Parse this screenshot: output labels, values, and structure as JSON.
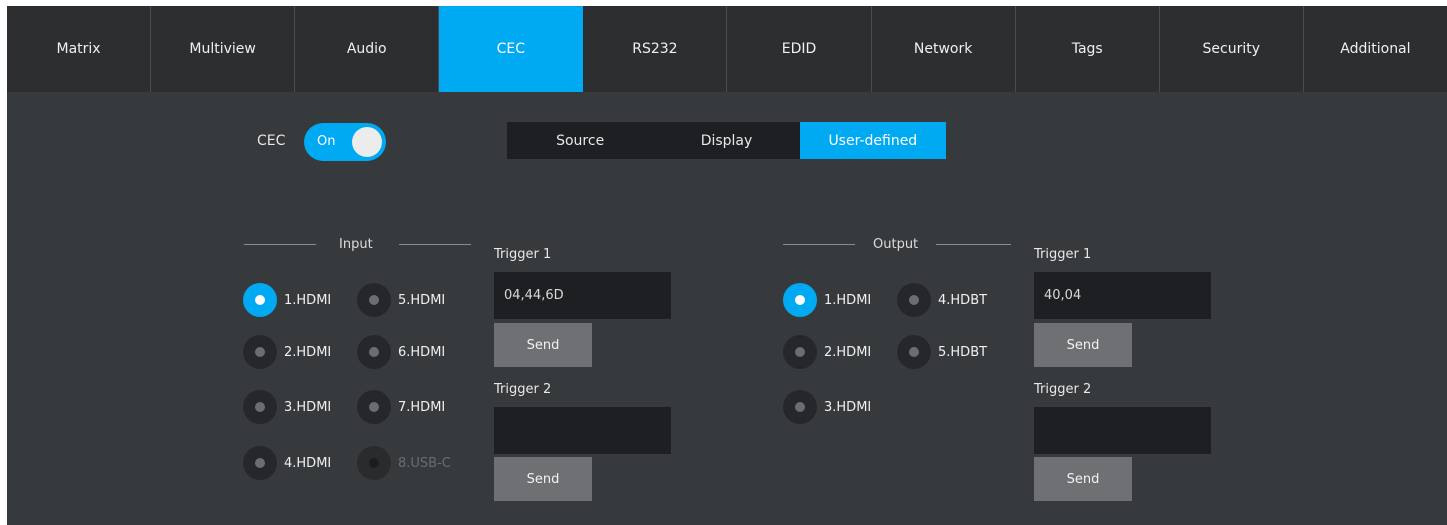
{
  "tabs": [
    {
      "label": "Matrix"
    },
    {
      "label": "Multiview"
    },
    {
      "label": "Audio"
    },
    {
      "label": "CEC"
    },
    {
      "label": "RS232"
    },
    {
      "label": "EDID"
    },
    {
      "label": "Network"
    },
    {
      "label": "Tags"
    },
    {
      "label": "Security"
    },
    {
      "label": "Additional"
    }
  ],
  "active_tab": "CEC",
  "cec": {
    "label": "CEC",
    "toggle_text": "On",
    "enabled": true
  },
  "mode_tabs": [
    {
      "label": "Source"
    },
    {
      "label": "Display"
    },
    {
      "label": "User-defined"
    }
  ],
  "active_mode": "User-defined",
  "input": {
    "title": "Input",
    "options": [
      {
        "label": "1.HDMI",
        "selected": true
      },
      {
        "label": "5.HDMI"
      },
      {
        "label": "2.HDMI"
      },
      {
        "label": "6.HDMI"
      },
      {
        "label": "3.HDMI"
      },
      {
        "label": "7.HDMI"
      },
      {
        "label": "4.HDMI"
      },
      {
        "label": "8.USB-C",
        "disabled": true
      }
    ],
    "trigger1": {
      "label": "Trigger 1",
      "value": "04,44,6D",
      "send": "Send"
    },
    "trigger2": {
      "label": "Trigger 2",
      "value": "",
      "send": "Send"
    }
  },
  "output": {
    "title": "Output",
    "options": [
      {
        "label": "1.HDMI",
        "selected": true
      },
      {
        "label": "4.HDBT"
      },
      {
        "label": "2.HDMI"
      },
      {
        "label": "5.HDBT"
      },
      {
        "label": "3.HDMI"
      }
    ],
    "trigger1": {
      "label": "Trigger 1",
      "value": "40,04",
      "send": "Send"
    },
    "trigger2": {
      "label": "Trigger 2",
      "value": "",
      "send": "Send"
    }
  },
  "colors": {
    "accent": "#00aaf2",
    "background": "#363a3d",
    "tabbar": "#2d2e30"
  }
}
